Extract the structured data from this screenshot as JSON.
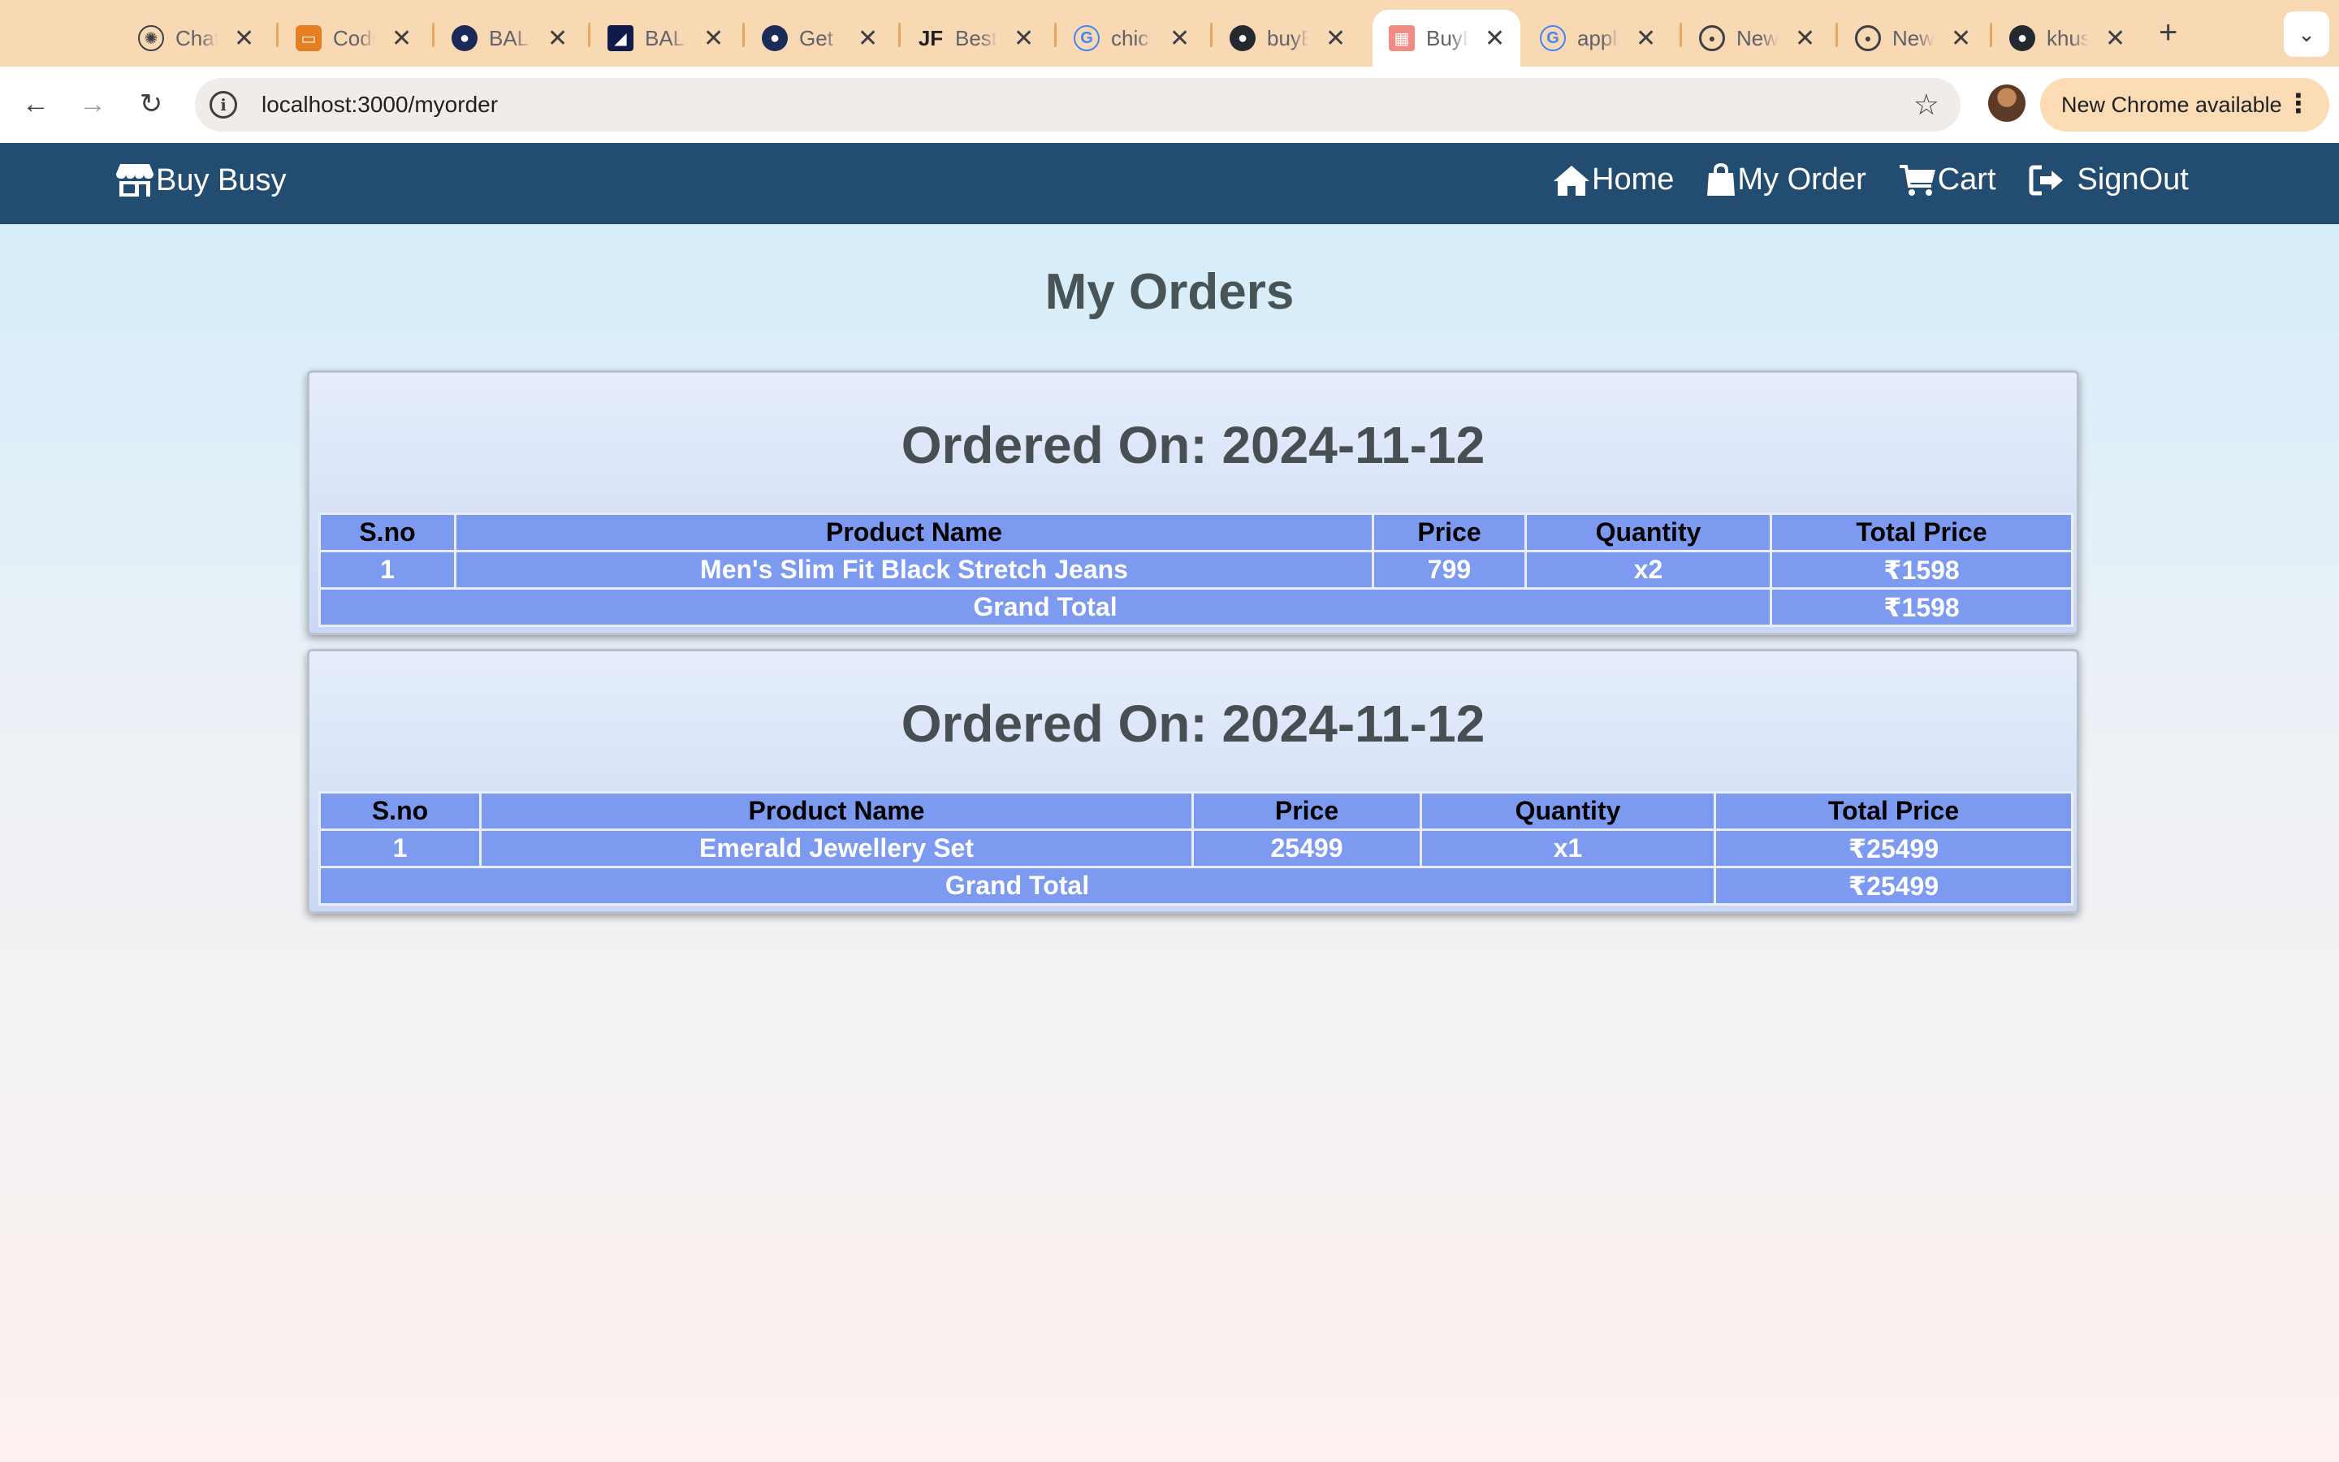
{
  "browser": {
    "tabs": [
      {
        "title": "ChatGPT",
        "icon": "openai-icon"
      },
      {
        "title": "Coding Ninjas",
        "icon": "codingninjas-icon"
      },
      {
        "title": "BALLERS",
        "icon": "ballers-icon"
      },
      {
        "title": "BALLERS",
        "icon": "ballers-dark-icon"
      },
      {
        "title": "Get",
        "icon": "ballers-icon"
      },
      {
        "title": "Best",
        "icon": "jf-icon"
      },
      {
        "title": "chic",
        "icon": "google-icon"
      },
      {
        "title": "buyBusy",
        "icon": "github-icon"
      },
      {
        "title": "BuyBusy",
        "icon": "store-icon",
        "active": true
      },
      {
        "title": "apple",
        "icon": "google-icon"
      },
      {
        "title": "New",
        "icon": "chrome-icon"
      },
      {
        "title": "New",
        "icon": "chrome-icon"
      },
      {
        "title": "khushi",
        "icon": "github-icon"
      }
    ],
    "url": "localhost:3000/myorder",
    "update_label": "New Chrome available"
  },
  "app": {
    "brand": "Buy Busy",
    "nav": {
      "home": "Home",
      "orders": "My Order",
      "cart": "Cart",
      "signout": "SignOut"
    },
    "colors": {
      "navbar": "#224d71",
      "table": "#7b9af0"
    }
  },
  "page": {
    "title": "My Orders"
  },
  "orders": [
    {
      "date_label": "Ordered On: 2024-11-12",
      "headers": [
        "S.no",
        "Product Name",
        "Price",
        "Quantity",
        "Total Price"
      ],
      "rows": [
        {
          "sno": "1",
          "name": "Men's Slim Fit Black Stretch Jeans",
          "price": "799",
          "qty": "x2",
          "total": "₹1598"
        }
      ],
      "grand_total_label": "Grand Total",
      "grand_total": "₹1598"
    },
    {
      "date_label": "Ordered On: 2024-11-12",
      "headers": [
        "S.no",
        "Product Name",
        "Price",
        "Quantity",
        "Total Price"
      ],
      "rows": [
        {
          "sno": "1",
          "name": "Emerald Jewellery Set",
          "price": "25499",
          "qty": "x1",
          "total": "₹25499"
        }
      ],
      "grand_total_label": "Grand Total",
      "grand_total": "₹25499"
    }
  ]
}
